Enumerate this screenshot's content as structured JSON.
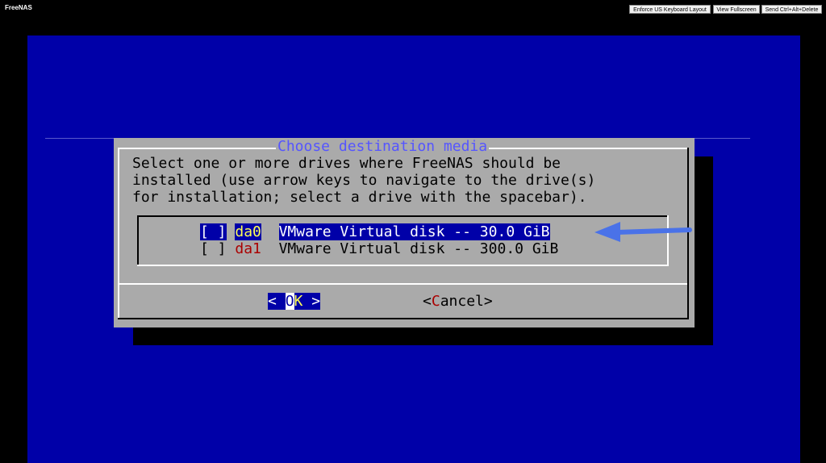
{
  "app_title": "FreeNAS",
  "toolbar": {
    "enforce_keyboard": "Enforce US Keyboard Layout",
    "view_fullscreen": "View Fullscreen",
    "send_cad": "Send Ctrl+Alt+Delete"
  },
  "dialog": {
    "title": "Choose destination media",
    "prompt_lines": [
      "Select one or more drives where FreeNAS should be",
      "installed (use arrow keys to navigate to the drive(s)",
      "for installation; select a drive with the spacebar)."
    ],
    "drives": [
      {
        "checkbox": "[ ]",
        "tag": "da0",
        "description": "VMware Virtual disk -- 30.0 GiB",
        "selected": false,
        "highlighted": true
      },
      {
        "checkbox": "[ ]",
        "tag": "da1",
        "description": "VMware Virtual disk -- 300.0 GiB",
        "selected": false,
        "highlighted": false
      }
    ],
    "ok_label": "OK",
    "cancel_label": "Cancel"
  },
  "colors": {
    "console_blue": "#0000a8",
    "dialog_gray": "#aaaaaa",
    "title_blue": "#5555ff",
    "hotkey_red": "#aa0000",
    "hotkey_yellow": "#ffff55",
    "arrow_blue": "#4a72e8"
  },
  "annotation": {
    "icon": "arrow-left-icon"
  }
}
